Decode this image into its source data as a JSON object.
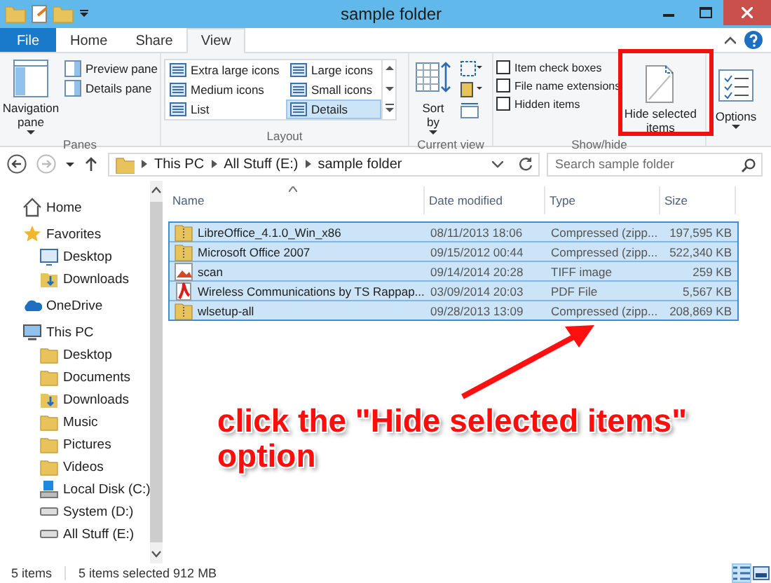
{
  "window": {
    "title": "sample folder"
  },
  "tabs": [
    {
      "label": "File",
      "kind": "file",
      "selected": false
    },
    {
      "label": "Home",
      "kind": "tab",
      "selected": false
    },
    {
      "label": "Share",
      "kind": "tab",
      "selected": false
    },
    {
      "label": "View",
      "kind": "tab",
      "selected": true
    }
  ],
  "ribbon": {
    "groups": [
      {
        "kind": "panes",
        "label": "Panes",
        "large": {
          "label": "Navigation pane"
        },
        "items": [
          {
            "label": "Preview pane"
          },
          {
            "label": "Details pane"
          }
        ]
      },
      {
        "kind": "layout",
        "label": "Layout",
        "options": [
          {
            "label": "Extra large icons",
            "selected": false
          },
          {
            "label": "Medium icons",
            "selected": false
          },
          {
            "label": "List",
            "selected": false
          },
          {
            "label": "Large icons",
            "selected": false
          },
          {
            "label": "Small icons",
            "selected": false
          },
          {
            "label": "Details",
            "selected": true
          }
        ]
      },
      {
        "kind": "current_view",
        "label": "Current view",
        "large": {
          "label": "Sort by"
        }
      },
      {
        "kind": "show_hide",
        "label": "Show/hide",
        "checkboxes": [
          {
            "label": "Item check boxes",
            "checked": false
          },
          {
            "label": "File name extensions",
            "checked": false
          },
          {
            "label": "Hidden items",
            "checked": false
          }
        ],
        "large": {
          "label": "Hide selected items"
        }
      },
      {
        "kind": "options",
        "large": {
          "label": "Options"
        }
      }
    ]
  },
  "address": {
    "crumbs": [
      "This PC",
      "All Stuff (E:)",
      "sample folder"
    ],
    "search_placeholder": "Search sample folder"
  },
  "sidebar": {
    "items": [
      {
        "label": "Home",
        "kind": "home"
      },
      {
        "label": "Favorites",
        "kind": "star",
        "children": [
          {
            "label": "Desktop",
            "kind": "desktop"
          },
          {
            "label": "Downloads",
            "kind": "downloads"
          }
        ]
      },
      {
        "label": "OneDrive",
        "kind": "cloud"
      },
      {
        "label": "This PC",
        "kind": "pc",
        "children": [
          {
            "label": "Desktop",
            "kind": "folder"
          },
          {
            "label": "Documents",
            "kind": "folder"
          },
          {
            "label": "Downloads",
            "kind": "downloads"
          },
          {
            "label": "Music",
            "kind": "folder"
          },
          {
            "label": "Pictures",
            "kind": "folder"
          },
          {
            "label": "Videos",
            "kind": "folder"
          },
          {
            "label": "Local Disk (C:)",
            "kind": "windisk"
          },
          {
            "label": "System (D:)",
            "kind": "drive"
          },
          {
            "label": "All Stuff (E:)",
            "kind": "drive"
          }
        ]
      }
    ]
  },
  "table": {
    "columns": [
      "Name",
      "Date modified",
      "Type",
      "Size"
    ],
    "rows": [
      {
        "kind": "zip",
        "name": "LibreOffice_4.1.0_Win_x86",
        "date": "08/11/2013 18:06",
        "type": "Compressed (zipp...",
        "size": "197,595 KB",
        "selected": true
      },
      {
        "kind": "zip",
        "name": "Microsoft Office 2007",
        "date": "09/15/2012 00:44",
        "type": "Compressed (zipp...",
        "size": "522,340 KB",
        "selected": true
      },
      {
        "kind": "image",
        "name": "scan",
        "date": "09/14/2014 20:28",
        "type": "TIFF image",
        "size": "259 KB",
        "selected": true
      },
      {
        "kind": "pdf",
        "name": "Wireless Communications by TS Rappap...",
        "date": "03/09/2014 20:03",
        "type": "PDF File",
        "size": "5,567 KB",
        "selected": true
      },
      {
        "kind": "zip",
        "name": "wlsetup-all",
        "date": "09/28/2013 13:09",
        "type": "Compressed (zipp...",
        "size": "208,869 KB",
        "selected": true
      }
    ]
  },
  "annotation": {
    "text": "click the \"Hide selected items\" option"
  },
  "status_bar": {
    "count": "5 items",
    "selection": "5 items selected  912 MB",
    "view_buttons": [
      {
        "kind": "details",
        "selected": true
      },
      {
        "kind": "large",
        "selected": false
      }
    ]
  }
}
